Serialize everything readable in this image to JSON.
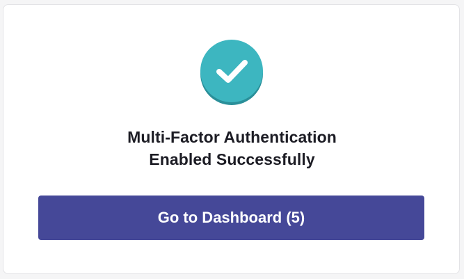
{
  "success": {
    "icon": "checkmark-circle-icon",
    "title_line1": "Multi-Factor Authentication",
    "title_line2": "Enabled Successfully"
  },
  "actions": {
    "dashboard_label": "Go to Dashboard (5)"
  },
  "colors": {
    "icon_primary": "#3db6c0",
    "icon_shadow": "#2a8f99",
    "button_bg": "#454898",
    "button_text": "#ffffff"
  }
}
